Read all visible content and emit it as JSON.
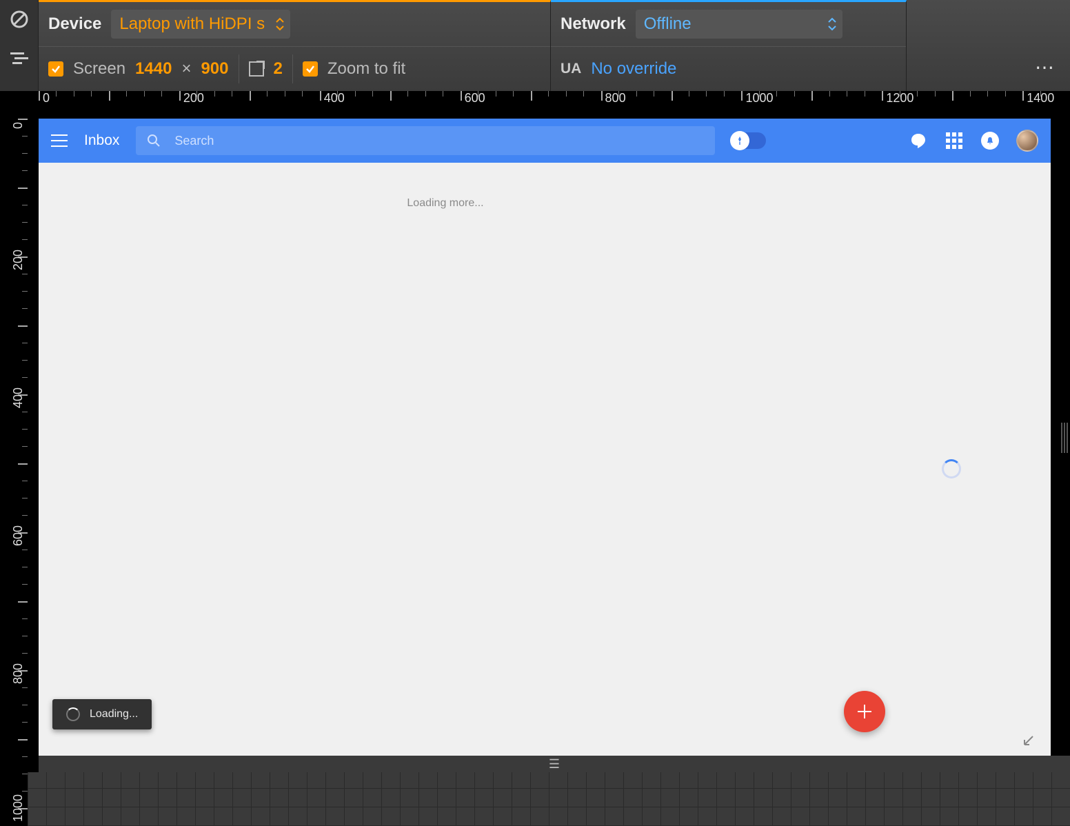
{
  "devtools": {
    "device_label": "Device",
    "device_value": "Laptop with HiDPI s",
    "network_label": "Network",
    "network_value": "Offline",
    "screen_label": "Screen",
    "screen_w": "1440",
    "screen_x": "×",
    "screen_h": "900",
    "dpr_value": "2",
    "zoom_label": "Zoom to fit",
    "ua_label": "UA",
    "ua_value": "No override",
    "ruler_origin": "0"
  },
  "ruler_h": [
    "0",
    "200",
    "400",
    "600",
    "800",
    "1000",
    "1200",
    "1400"
  ],
  "ruler_v": [
    "0",
    "200",
    "400",
    "600",
    "800",
    "1000"
  ],
  "inbox": {
    "brand": "Inbox",
    "search_placeholder": "Search",
    "loading_more": "Loading more...",
    "toast": "Loading..."
  }
}
